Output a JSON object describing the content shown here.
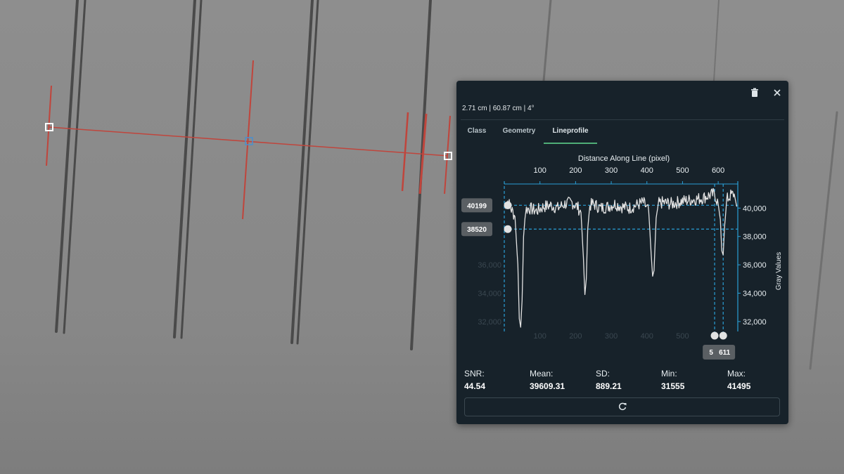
{
  "panel": {
    "measurement": "2.71 cm | 60.87 cm | 4°",
    "tabs": [
      {
        "label": "Class",
        "active": false
      },
      {
        "label": "Geometry",
        "active": false
      },
      {
        "label": "Lineprofile",
        "active": true
      }
    ],
    "icons": {
      "delete": "trash-icon",
      "close": "close-icon",
      "refresh": "refresh-icon"
    }
  },
  "chart_data": {
    "type": "line",
    "title": "",
    "xlabel": "Distance Along Line (pixel)",
    "ylabel": "Gray Values",
    "x_ticks": [
      100,
      200,
      300,
      400,
      500,
      600
    ],
    "y_ticks": [
      "40,000",
      "38,000",
      "36,000",
      "34,000",
      "32,000"
    ],
    "y_tick_values": [
      40000,
      38000,
      36000,
      34000,
      32000
    ],
    "xlim": [
      0,
      655
    ],
    "ylim": [
      31500,
      41700
    ],
    "grid": false,
    "series": [
      {
        "x": [
          0,
          10,
          20,
          30,
          38,
          42,
          46,
          50,
          54,
          60,
          70,
          90,
          110,
          130,
          150,
          170,
          190,
          205,
          215,
          222,
          226,
          230,
          234,
          240,
          250,
          270,
          290,
          310,
          330,
          350,
          370,
          390,
          405,
          412,
          416,
          420,
          426,
          432,
          445,
          470,
          500,
          530,
          555,
          575,
          590,
          600,
          606,
          610,
          614,
          618,
          624,
          635,
          645,
          652
        ],
        "y": [
          40200,
          40500,
          39900,
          39400,
          36000,
          32200,
          31600,
          33500,
          38000,
          39900,
          40000,
          39800,
          40100,
          40200,
          40000,
          40300,
          40400,
          40100,
          39700,
          36500,
          33900,
          35000,
          38500,
          40200,
          40300,
          40000,
          40100,
          40300,
          40100,
          40000,
          40200,
          40400,
          39800,
          36800,
          35200,
          35600,
          39300,
          40300,
          40400,
          40300,
          40500,
          40600,
          40700,
          40900,
          41000,
          40300,
          39200,
          37000,
          36700,
          38700,
          40600,
          40900,
          41000,
          40100
        ]
      }
    ],
    "markers": {
      "y_values": [
        "40199",
        "38520"
      ],
      "x_values": [
        "5",
        "611"
      ]
    }
  },
  "stats": [
    {
      "label": "SNR:",
      "value": "44.54"
    },
    {
      "label": "Mean:",
      "value": "39609.31"
    },
    {
      "label": "SD:",
      "value": "889.21"
    },
    {
      "label": "Min:",
      "value": "31555"
    },
    {
      "label": "Max:",
      "value": "41495"
    }
  ],
  "colors": {
    "panel_bg": "#17222a",
    "accent": "#4fae77",
    "marker_line": "#2a9fd6",
    "annotation_line": "#c0453c",
    "handle_selected": "#4a8fd0"
  }
}
